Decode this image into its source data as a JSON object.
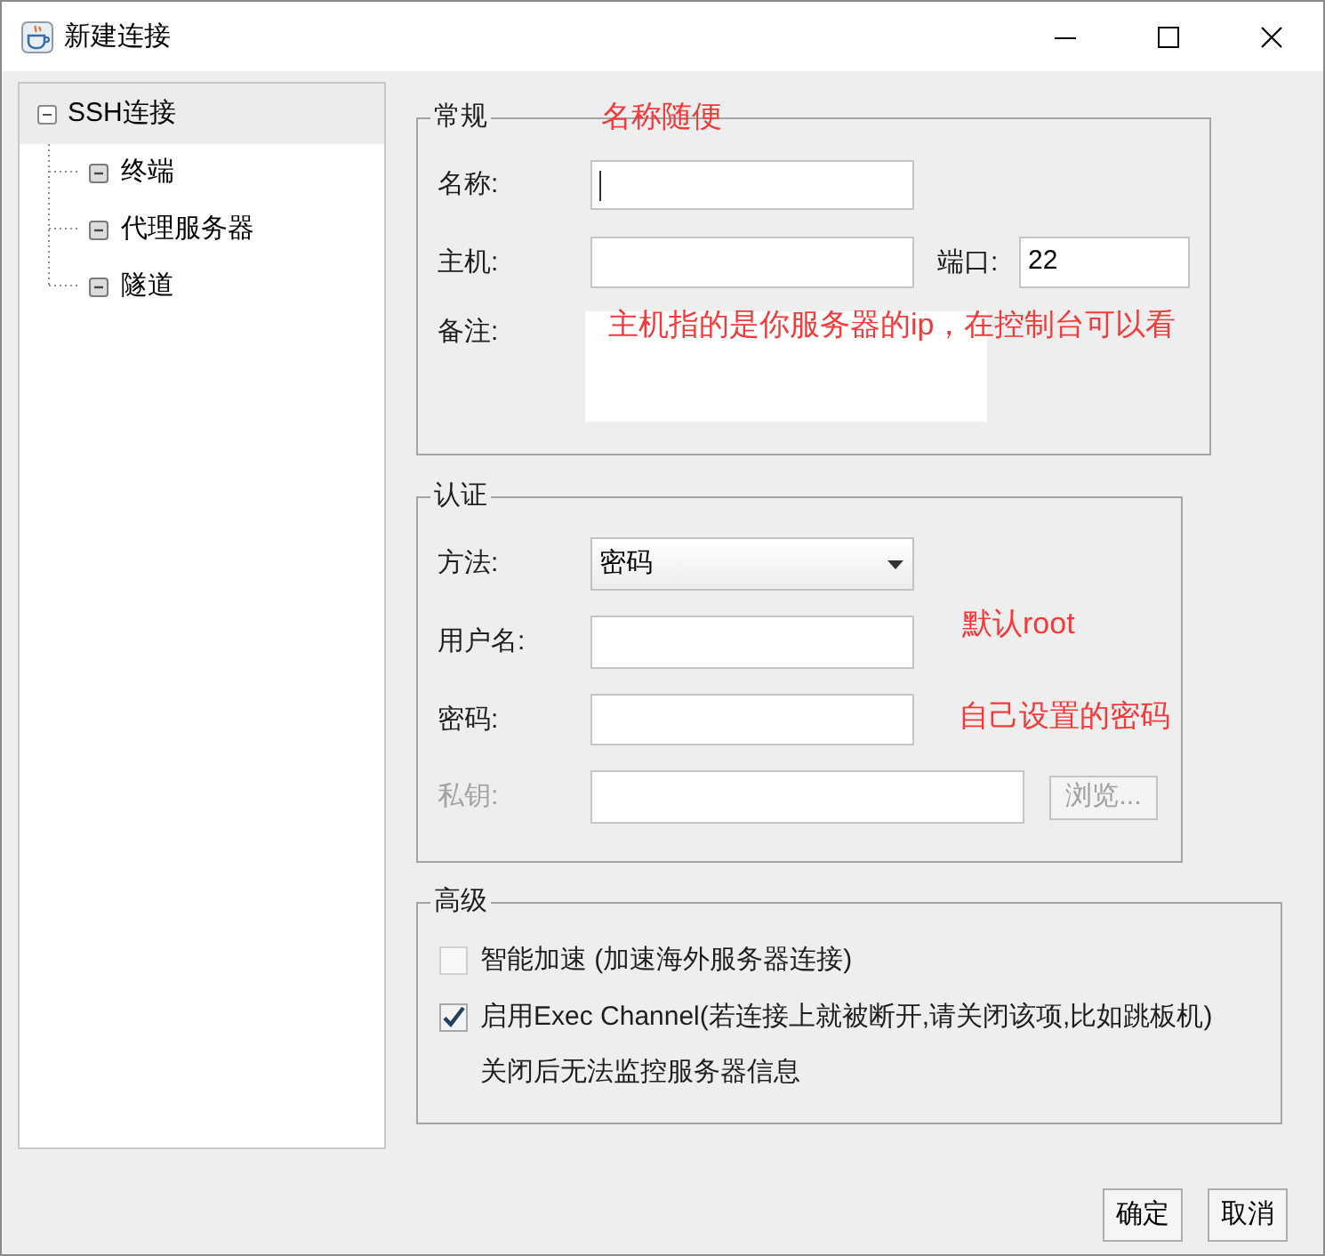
{
  "window": {
    "title": "新建连接"
  },
  "tree": [
    {
      "label": "SSH连接",
      "selected": true,
      "expanded": true,
      "children": [
        {
          "label": "终端",
          "selected": false
        },
        {
          "label": "代理服务器",
          "selected": false
        },
        {
          "label": "隧道",
          "selected": false
        }
      ]
    }
  ],
  "general": {
    "legend": "常规",
    "annotation": "名称随便",
    "name": {
      "label": "名称:",
      "focused": true
    },
    "host": {
      "label": "主机:"
    },
    "port": {
      "label": "端口:",
      "value": "22"
    },
    "remark": {
      "label": "备注:",
      "annotation": "主机指的是你服务器的ip，在控制台可以看"
    }
  },
  "auth": {
    "legend": "认证",
    "method": {
      "label": "方法:",
      "value": "密码"
    },
    "username": {
      "label": "用户名:",
      "annotation": "默认root"
    },
    "password": {
      "label": "密码:",
      "annotation": "自己设置的密码"
    },
    "private_key": {
      "label": "私钥:",
      "disabled": true,
      "browse_button": {
        "label": "浏览...",
        "disabled": true
      }
    }
  },
  "advanced": {
    "legend": "高级",
    "options": [
      {
        "label": "智能加速 (加速海外服务器连接)",
        "checked": false
      },
      {
        "label": "启用Exec Channel(若连接上就被断开,请关闭该项,比如跳板机)",
        "checked": true
      }
    ],
    "note": "关闭后无法监控服务器信息"
  },
  "buttons": [
    {
      "label": "确定"
    },
    {
      "label": "取消"
    }
  ]
}
